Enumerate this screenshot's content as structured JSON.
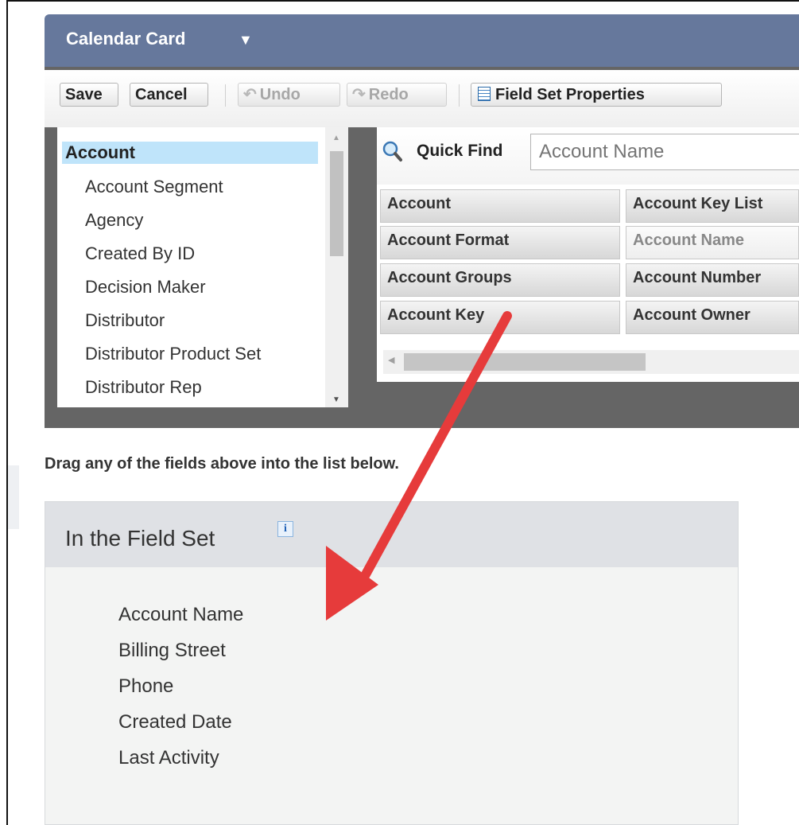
{
  "header": {
    "title": "Calendar Card"
  },
  "toolbar": {
    "save": "Save",
    "cancel": "Cancel",
    "undo": "Undo",
    "redo": "Redo",
    "field_set_properties": "Field Set Properties"
  },
  "object_list": {
    "selected": "Account",
    "items": [
      "Account Segment",
      "Agency",
      "Created By ID",
      "Decision Maker",
      "Distributor",
      "Distributor Product Set",
      "Distributor Rep"
    ]
  },
  "quick_find": {
    "label": "Quick Find",
    "placeholder": "Account Name"
  },
  "fields": {
    "col1": [
      "Account",
      "Account Format",
      "Account Groups",
      "Account Key"
    ],
    "col2": [
      "Account Key List",
      "Account Name",
      "Account Number",
      "Account Owner"
    ]
  },
  "instruction": "Drag any of the fields above into the list below.",
  "field_set": {
    "title": "In the Field Set",
    "info_icon_label": "i",
    "members": [
      "Account Name",
      "Billing Street",
      "Phone",
      "Created Date",
      "Last Activity"
    ]
  },
  "colors": {
    "header": "#66789c",
    "selected_row": "#bfe4fa",
    "annotation_arrow": "#e63b3b"
  },
  "icons": [
    "chevron-down-icon",
    "undo-icon",
    "redo-icon",
    "field-set-properties-icon",
    "search-icon",
    "info-icon",
    "scroll-up-icon",
    "scroll-down-icon",
    "scroll-left-icon"
  ]
}
